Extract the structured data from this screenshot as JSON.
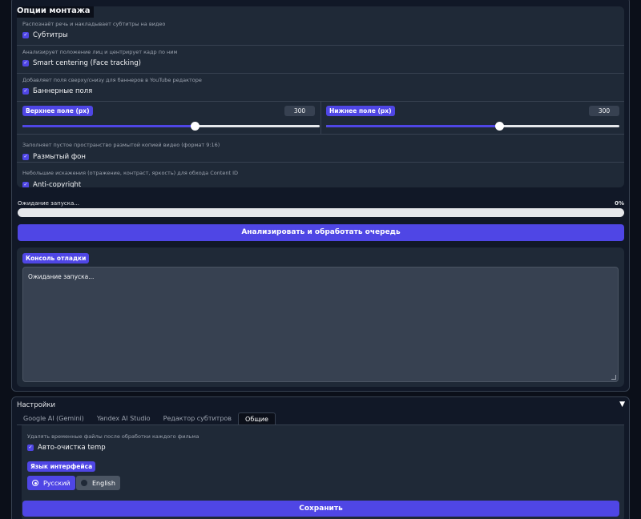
{
  "montage": {
    "title": "Опции монтажа",
    "subtitles": {
      "desc": "Распознаёт речь и накладывает субтитры на видео",
      "label": "Субтитры",
      "checked": true
    },
    "smart_centering": {
      "desc": "Анализирует положение лиц и центрирует кадр по ним",
      "label": "Smart centering (Face tracking)",
      "checked": true
    },
    "banner_fields": {
      "desc": "Добавляет поля сверху/снизу для баннеров в YouTube редакторе",
      "label": "Баннерные поля",
      "checked": true
    },
    "top_field": {
      "label": "Верхнее поле (px)",
      "value": "300",
      "slider_fraction": 0.58
    },
    "bottom_field": {
      "label": "Нижнее поле (px)",
      "value": "300",
      "slider_fraction": 0.59
    },
    "blur_bg": {
      "desc": "Заполняет пустое пространство размытой копией видео (формат 9:16)",
      "label": "Размытый фон",
      "checked": true
    },
    "anti_copyright": {
      "desc": "Небольшие искажения (отражение, контраст, яркость) для обхода Content ID",
      "label": "Anti-copyright",
      "checked": true
    }
  },
  "progress": {
    "status": "Ожидание запуска...",
    "percent_text": "0%",
    "fraction": 0
  },
  "process_button": "Анализировать и обработать очередь",
  "console": {
    "label": "Консоль отладки",
    "text": "Ожидание запуска..."
  },
  "settings": {
    "title": "Настройки",
    "collapse_icon": "▼",
    "tabs": [
      {
        "label": "Google AI (Gemini)",
        "active": false
      },
      {
        "label": "Yandex AI Studio",
        "active": false
      },
      {
        "label": "Редактор субтитров",
        "active": false
      },
      {
        "label": "Общие",
        "active": true
      }
    ],
    "auto_clean": {
      "desc": "Удалять временные файлы после обработки каждого фильма",
      "label": "Авто-очистка temp",
      "checked": true
    },
    "language": {
      "label": "Язык интерфейса",
      "options": [
        {
          "label": "Русский",
          "selected": true
        },
        {
          "label": "English",
          "selected": false
        }
      ]
    },
    "save_button": "Сохранить"
  },
  "colors": {
    "accent": "#4f46e5",
    "panel": "#1f2937",
    "background": "#0b0f19"
  }
}
